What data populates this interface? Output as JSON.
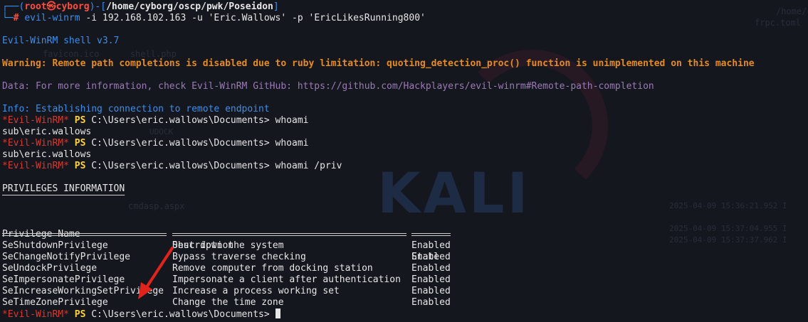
{
  "prompt": {
    "corner_top": "┌──(",
    "user": "root㉿cyborg",
    "sep": ")-[",
    "path": "/home/cyborg/oscp/pwk/Poseidon",
    "close": "]",
    "corner_bottom": "└─",
    "hash": "# ",
    "cmd_bin": "evil-winrm",
    "cmd_args": " -i 192.168.102.163 -u 'Eric.Wallows' -p 'EricLikesRunning800'"
  },
  "output": {
    "banner": "Evil-WinRM shell v3.7",
    "warning": "Warning: Remote path completions is disabled due to ruby limitation: quoting_detection_proc() function is unimplemented on this machine",
    "data_line": "Data: For more information, check Evil-WinRM GitHub: https://github.com/Hackplayers/evil-winrm#Remote-path-completion",
    "info_line": "Info: Establishing connection to remote endpoint"
  },
  "shell": {
    "prompt_tag": "*Evil-WinRM*",
    "ps": "PS",
    "cwd": "C:\\Users\\eric.wallows\\Documents>",
    "cmd1": "whoami",
    "out1": "sub\\eric.wallows",
    "cmd2": "whoami",
    "out2": "sub\\eric.wallows",
    "cmd3": "whoami /priv"
  },
  "privileges": {
    "title": "PRIVILEGES INFORMATION",
    "title_rule": "----------------------",
    "headers": {
      "name": "Privilege Name",
      "desc": "Description",
      "state": "State"
    },
    "rows": [
      {
        "name": "SeShutdownPrivilege",
        "desc": "Shut down the system",
        "state": "Enabled"
      },
      {
        "name": "SeChangeNotifyPrivilege",
        "desc": "Bypass traverse checking",
        "state": "Enabled"
      },
      {
        "name": "SeUndockPrivilege",
        "desc": "Remove computer from docking station",
        "state": "Enabled"
      },
      {
        "name": "SeImpersonatePrivilege",
        "desc": "Impersonate a client after authentication",
        "state": "Enabled"
      },
      {
        "name": "SeIncreaseWorkingSetPrivilege",
        "desc": "Increase a process working set",
        "state": "Enabled"
      },
      {
        "name": "SeTimeZonePrivilege",
        "desc": "Change the time zone",
        "state": "Enabled"
      }
    ]
  },
  "background": {
    "watermark": "KALI",
    "ghost_path": "/home/",
    "ghost_file": "frpc.toml",
    "ghost_icons": "favicon.ico      shell.php",
    "ghost_undock": "UDOCK",
    "ghost_aspx": "cmdasp.aspx",
    "ghost_log": [
      "2025-04-09 15:36:21.952 I",
      "2025-04-09 15:37:04.955 I",
      "2025-04-09 15:37:37.962 I"
    ]
  },
  "colors": {
    "background": "#15171f",
    "prompt_blue": "#3b8eea",
    "prompt_red": "#ff4d3d",
    "warning": "#e58b1f",
    "data": "#9a7ab5",
    "annotation_arrow": "#e0241b"
  }
}
